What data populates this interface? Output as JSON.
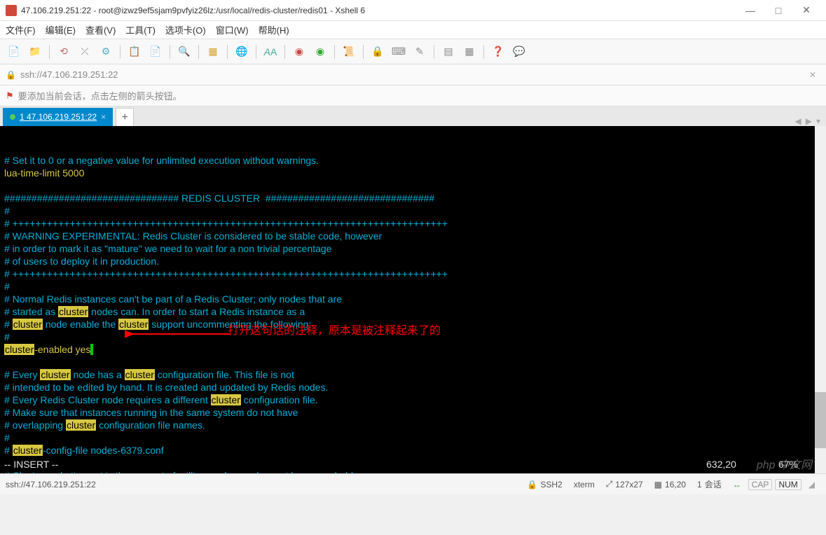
{
  "window": {
    "title": "47.106.219.251:22 - root@izwz9ef5sjam9pvfyiz26lz:/usr/local/redis-cluster/redis01 - Xshell 6"
  },
  "menu": {
    "file": "文件(F)",
    "edit": "编辑(E)",
    "view": "查看(V)",
    "tools": "工具(T)",
    "tab": "选项卡(O)",
    "window": "窗口(W)",
    "help": "帮助(H)"
  },
  "address": {
    "url": "ssh://47.106.219.251:22"
  },
  "hint": {
    "text": "要添加当前会话，点击左侧的箭头按钮。"
  },
  "tab_active": {
    "label": "1 47.106.219.251:22"
  },
  "terminal": {
    "lines": [
      {
        "t": "cyan",
        "txt": "# Set it to 0 or a negative value for unlimited execution without warnings."
      },
      {
        "t": "yellow",
        "txt": "lua-time-limit 5000"
      },
      {
        "t": "blank",
        "txt": ""
      },
      {
        "t": "cyan",
        "txt": "################################ REDIS CLUSTER  ###############################"
      },
      {
        "t": "cyan",
        "txt": "#"
      },
      {
        "t": "cyan",
        "txt": "# ++++++++++++++++++++++++++++++++++++++++++++++++++++++++++++++++++++++++++++"
      },
      {
        "t": "cyan",
        "txt": "# WARNING EXPERIMENTAL: Redis Cluster is considered to be stable code, however"
      },
      {
        "t": "cyan",
        "txt": "# in order to mark it as \"mature\" we need to wait for a non trivial percentage"
      },
      {
        "t": "cyan",
        "txt": "# of users to deploy it in production."
      },
      {
        "t": "cyan",
        "txt": "# ++++++++++++++++++++++++++++++++++++++++++++++++++++++++++++++++++++++++++++"
      },
      {
        "t": "cyan",
        "txt": "#"
      },
      {
        "t": "mix",
        "parts": [
          {
            "s": "cyan",
            "v": "# Normal Redis instances can't be part of a Redis Cluster; only nodes that are"
          }
        ]
      },
      {
        "t": "mix",
        "parts": [
          {
            "s": "cyan",
            "v": "# started as "
          },
          {
            "s": "hl",
            "v": "cluster"
          },
          {
            "s": "cyan",
            "v": " nodes can. In order to start a Redis instance as a"
          }
        ]
      },
      {
        "t": "mix",
        "parts": [
          {
            "s": "cyan",
            "v": "# "
          },
          {
            "s": "hl",
            "v": "cluster"
          },
          {
            "s": "cyan",
            "v": " node enable the "
          },
          {
            "s": "hl",
            "v": "cluster"
          },
          {
            "s": "cyan",
            "v": " support uncommenting the following:"
          }
        ]
      },
      {
        "t": "cyan",
        "txt": "#"
      },
      {
        "t": "mix",
        "parts": [
          {
            "s": "hl",
            "v": "cluster"
          },
          {
            "s": "yellow",
            "v": "-enabled yes"
          },
          {
            "s": "cursor",
            "v": " "
          }
        ]
      },
      {
        "t": "blank",
        "txt": ""
      },
      {
        "t": "mix",
        "parts": [
          {
            "s": "cyan",
            "v": "# Every "
          },
          {
            "s": "hl",
            "v": "cluster"
          },
          {
            "s": "cyan",
            "v": " node has a "
          },
          {
            "s": "hl",
            "v": "cluster"
          },
          {
            "s": "cyan",
            "v": " configuration file. This file is not"
          }
        ]
      },
      {
        "t": "cyan",
        "txt": "# intended to be edited by hand. It is created and updated by Redis nodes."
      },
      {
        "t": "mix",
        "parts": [
          {
            "s": "cyan",
            "v": "# Every Redis Cluster node requires a different "
          },
          {
            "s": "hl",
            "v": "cluster"
          },
          {
            "s": "cyan",
            "v": " configuration file."
          }
        ]
      },
      {
        "t": "cyan",
        "txt": "# Make sure that instances running in the same system do not have"
      },
      {
        "t": "mix",
        "parts": [
          {
            "s": "cyan",
            "v": "# overlapping "
          },
          {
            "s": "hl",
            "v": "cluster"
          },
          {
            "s": "cyan",
            "v": " configuration file names."
          }
        ]
      },
      {
        "t": "cyan",
        "txt": "#"
      },
      {
        "t": "mix",
        "parts": [
          {
            "s": "cyan",
            "v": "# "
          },
          {
            "s": "hl",
            "v": "cluster"
          },
          {
            "s": "cyan",
            "v": "-config-file nodes-6379.conf"
          }
        ]
      },
      {
        "t": "blank",
        "txt": ""
      },
      {
        "t": "cyan",
        "txt": "# Cluster node timeout is the amount of milliseconds a node must be unreachable"
      }
    ],
    "mode_line": {
      "mode": "-- INSERT --",
      "pos": "632,20",
      "pct": "67%"
    },
    "annotation": "打开这句话的注释，原本是被注释起来了的"
  },
  "status": {
    "left": "ssh://47.106.219.251:22",
    "ssh": "SSH2",
    "term": "xterm",
    "size": "127x27",
    "cursor": "16,20",
    "sess_label": "会话",
    "sess": "1",
    "cap": "CAP",
    "num": "NUM"
  },
  "watermark": "php 中文网"
}
